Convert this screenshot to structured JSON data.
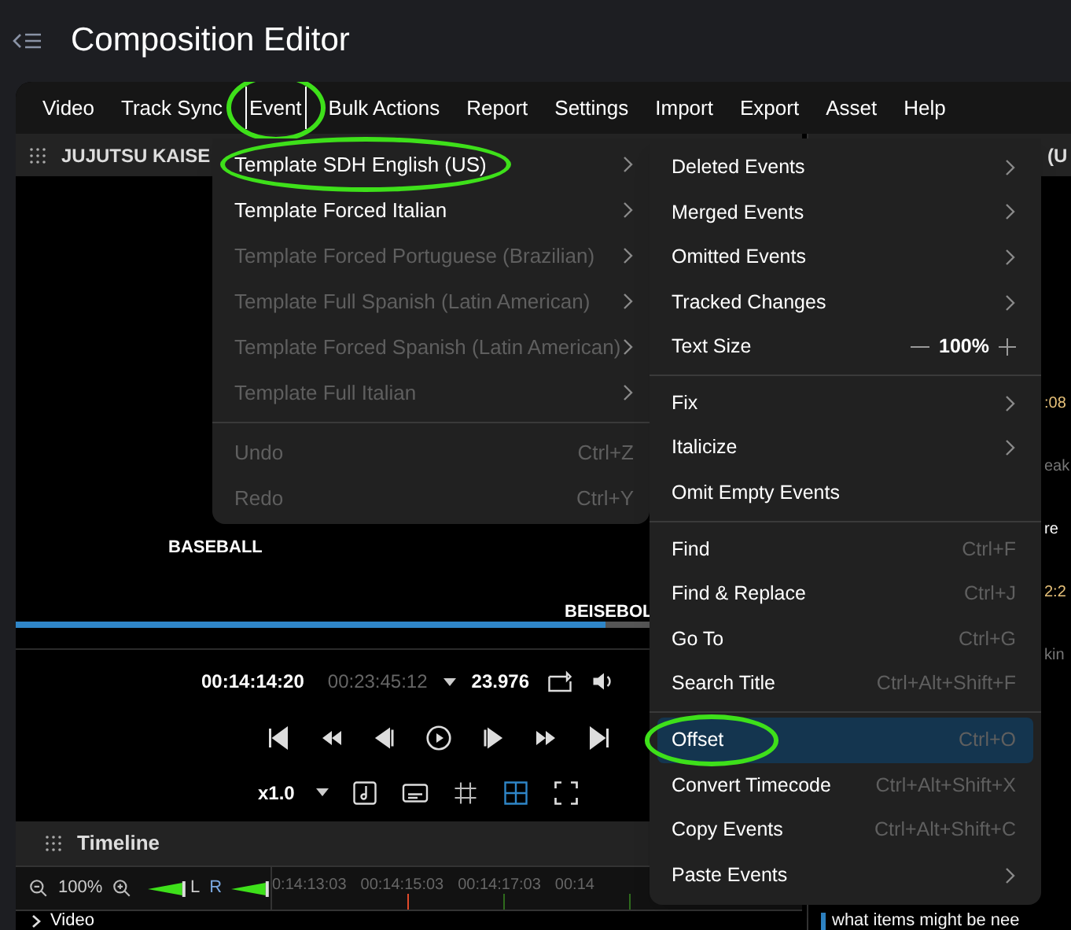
{
  "header": {
    "title": "Composition Editor"
  },
  "menubar": [
    {
      "label": "Video",
      "selected": false,
      "circled": false
    },
    {
      "label": "Track Sync",
      "selected": false,
      "circled": false
    },
    {
      "label": "Event",
      "selected": true,
      "circled": true
    },
    {
      "label": "Bulk Actions",
      "selected": false,
      "circled": false
    },
    {
      "label": "Report",
      "selected": false,
      "circled": false
    },
    {
      "label": "Settings",
      "selected": false,
      "circled": false
    },
    {
      "label": "Import",
      "selected": false,
      "circled": false
    },
    {
      "label": "Export",
      "selected": false,
      "circled": false
    },
    {
      "label": "Asset",
      "selected": false,
      "circled": false
    },
    {
      "label": "Help",
      "selected": false,
      "circled": false
    }
  ],
  "video_panel": {
    "title": "JUJUTSU KAISE",
    "subtitles": [
      "BASEBALL",
      "BEISEBOL"
    ],
    "progress": {
      "level": 0.75
    },
    "current_time": "00:14:14:20",
    "duration": "00:23:45:12",
    "frame_rate": "23.976",
    "speed": "x1.0",
    "grid_selected": true
  },
  "timeline": {
    "title": "Timeline",
    "zoom": "100%",
    "left_channel": "L",
    "right_channel": "R",
    "ticks": [
      "0:14:13:03",
      "00:14:15:03",
      "00:14:17:03",
      "00:14"
    ],
    "track": "Video"
  },
  "template_menu": {
    "sections": [
      [
        {
          "label": "Template SDH English (US)",
          "disabled": false,
          "circled": true,
          "submenu": true
        },
        {
          "label": "Template Forced Italian",
          "disabled": false,
          "circled": false,
          "submenu": true
        },
        {
          "label": "Template Forced Portuguese (Brazilian)",
          "disabled": true,
          "circled": false,
          "submenu": true
        },
        {
          "label": "Template Full Spanish (Latin American)",
          "disabled": true,
          "circled": false,
          "submenu": true
        },
        {
          "label": "Template Forced Spanish (Latin American)",
          "disabled": true,
          "circled": false,
          "submenu": true
        },
        {
          "label": "Template Full Italian",
          "disabled": true,
          "circled": false,
          "submenu": true
        }
      ],
      [
        {
          "label": "Undo",
          "disabled": true,
          "circled": false,
          "shortcut": "Ctrl+Z"
        },
        {
          "label": "Redo",
          "disabled": true,
          "circled": false,
          "shortcut": "Ctrl+Y"
        }
      ]
    ]
  },
  "event_menu": {
    "sections": [
      [
        {
          "kind": "item",
          "label": "Deleted Events",
          "submenu": true,
          "selected": false,
          "circled": false
        },
        {
          "kind": "item",
          "label": "Merged Events",
          "submenu": true,
          "selected": false,
          "circled": false
        },
        {
          "kind": "item",
          "label": "Omitted Events",
          "submenu": true,
          "selected": false,
          "circled": false
        },
        {
          "kind": "item",
          "label": "Tracked Changes",
          "submenu": true,
          "selected": false,
          "circled": false
        },
        {
          "kind": "stepper",
          "label": "Text Size",
          "value": "100%",
          "selected": false,
          "circled": false
        }
      ],
      [
        {
          "kind": "item",
          "label": "Fix",
          "submenu": true,
          "selected": false,
          "circled": false
        },
        {
          "kind": "item",
          "label": "Italicize",
          "submenu": true,
          "selected": false,
          "circled": false
        },
        {
          "kind": "item",
          "label": "Omit Empty Events",
          "submenu": false,
          "selected": false,
          "circled": false
        }
      ],
      [
        {
          "kind": "item",
          "label": "Find",
          "shortcut": "Ctrl+F",
          "selected": false,
          "circled": false
        },
        {
          "kind": "item",
          "label": "Find & Replace",
          "shortcut": "Ctrl+J",
          "selected": false,
          "circled": false
        },
        {
          "kind": "item",
          "label": "Go To",
          "shortcut": "Ctrl+G",
          "selected": false,
          "circled": false
        },
        {
          "kind": "item",
          "label": "Search Title",
          "shortcut": "Ctrl+Alt+Shift+F",
          "selected": false,
          "circled": false
        }
      ],
      [
        {
          "kind": "item",
          "label": "Offset",
          "shortcut": "Ctrl+O",
          "selected": true,
          "circled": true
        },
        {
          "kind": "item",
          "label": "Convert Timecode",
          "shortcut": "Ctrl+Alt+Shift+X",
          "selected": false,
          "circled": false
        },
        {
          "kind": "item",
          "label": "Copy Events",
          "shortcut": "Ctrl+Alt+Shift+C",
          "selected": false,
          "circled": false
        },
        {
          "kind": "item",
          "label": "Paste Events",
          "submenu": true,
          "selected": false,
          "circled": false
        }
      ]
    ]
  },
  "side_panel": {
    "title": "(U",
    "fragments": [
      {
        "text": ":08",
        "kind": "time"
      },
      {
        "text": "eak",
        "kind": "muted"
      },
      {
        "text": "re",
        "kind": "text"
      },
      {
        "text": "2:2",
        "kind": "time"
      },
      {
        "text": "kin",
        "kind": "muted"
      }
    ],
    "active_text": "what items might be nee"
  }
}
